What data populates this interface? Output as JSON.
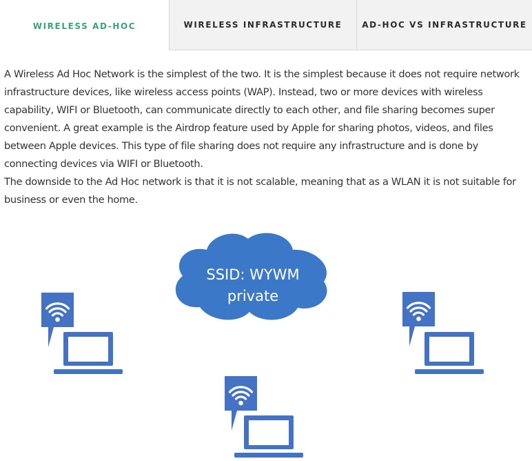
{
  "tabs": [
    {
      "label": "WIRELESS AD-HOC",
      "active": true
    },
    {
      "label": "WIRELESS INFRASTRUCTURE",
      "active": false
    },
    {
      "label": "AD-HOC VS INFRASTRUCTURE",
      "active": false
    }
  ],
  "content": {
    "paragraph1": "A Wireless Ad Hoc Network is the simplest of the two. It is the simplest because it does not require network infrastructure devices, like wireless access points (WAP). Instead, two or more devices with wireless capability, WIFI or Bluetooth, can communicate directly to each other, and file sharing becomes super convenient. A great example is the Airdrop feature used by Apple for sharing photos, videos, and files between Apple devices. This type of file sharing does not require any infrastructure and is done by connecting devices via WIFI or Bluetooth.",
    "paragraph2": "The downside to the Ad Hoc network is that it is not scalable, meaning that as a WLAN it is not suitable for business or even the home."
  },
  "diagram": {
    "cloud_line1": "SSID: WYWM",
    "cloud_line2": "private",
    "icons": [
      "wifi-icon",
      "laptop-icon",
      "cloud-icon"
    ],
    "colors": {
      "cloud": "#3c78c8",
      "device": "#4472c4",
      "active_tab": "#3aa17e"
    }
  }
}
